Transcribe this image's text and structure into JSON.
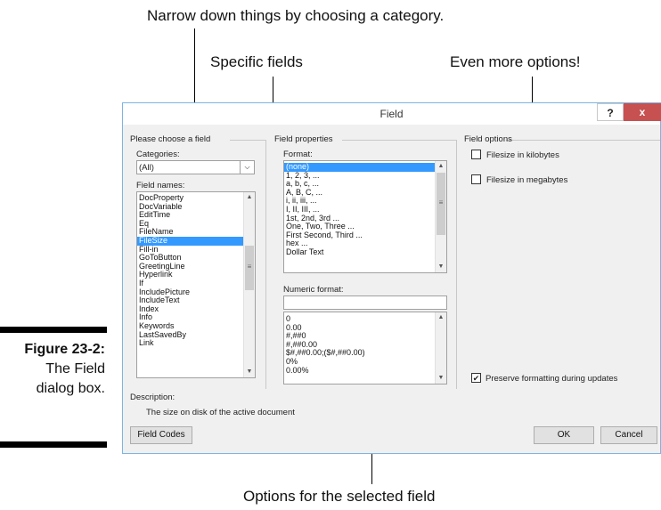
{
  "annotations": {
    "category": "Narrow down things by choosing a category.",
    "specific_fields": "Specific fields",
    "more_options": "Even more options!",
    "selected_field_options": "Options for the selected field"
  },
  "caption": {
    "figure": "Figure 23-2:",
    "line1": "The Field",
    "line2": "dialog box."
  },
  "dialog": {
    "title": "Field",
    "help_label": "?",
    "close_label": "x",
    "choose_group": "Please choose a field",
    "categories_label": "Categories:",
    "categories_value": "(All)",
    "field_names_label": "Field names:",
    "field_names": [
      "DocProperty",
      "DocVariable",
      "EditTime",
      "Eq",
      "FileName",
      "FileSize",
      "Fill-in",
      "GoToButton",
      "GreetingLine",
      "Hyperlink",
      "If",
      "IncludePicture",
      "IncludeText",
      "Index",
      "Info",
      "Keywords",
      "LastSavedBy",
      "Link"
    ],
    "selected_field": "FileSize",
    "properties_group": "Field properties",
    "format_label": "Format:",
    "formats": [
      "(none)",
      "1, 2, 3, ...",
      "a, b, c, ...",
      "A, B, C, ...",
      "i, ii, iii, ...",
      "I, II, III, ...",
      "1st, 2nd, 3rd ...",
      "One, Two, Three ...",
      "First Second, Third ...",
      "hex ...",
      "Dollar Text"
    ],
    "selected_format": "(none)",
    "numeric_format_label": "Numeric format:",
    "numeric_format_value": "",
    "numeric_formats": [
      "0",
      "0.00",
      "#,##0",
      "#,##0.00",
      "$#,##0.00;($#,##0.00)",
      "0%",
      "0.00%"
    ],
    "options_group": "Field options",
    "option_kilobytes": "Filesize in kilobytes",
    "option_megabytes": "Filesize in megabytes",
    "option_kilobytes_checked": false,
    "option_megabytes_checked": false,
    "preserve_label": "Preserve formatting during updates",
    "preserve_checked": true,
    "description_label": "Description:",
    "description_text": "The size on disk of the active document",
    "field_codes_button": "Field Codes",
    "ok_button": "OK",
    "cancel_button": "Cancel",
    "icons": {
      "dropdown": "chevron-down-icon",
      "scroll_up": "scroll-up-arrow-icon",
      "scroll_down": "scroll-down-arrow-icon",
      "check": "check-mark-icon"
    }
  }
}
